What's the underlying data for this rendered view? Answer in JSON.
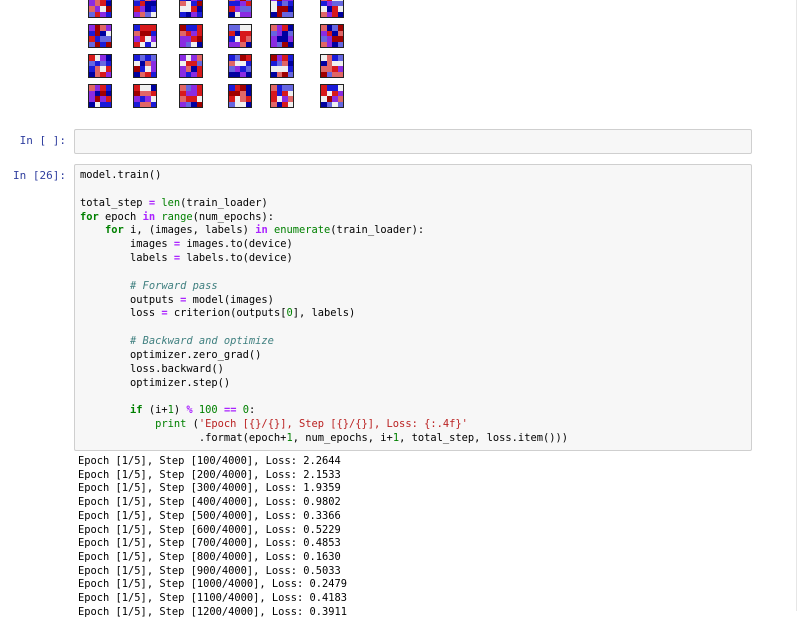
{
  "filter_colors": {
    "red": "#d7191c",
    "blue": "#1a1ad8",
    "light": "#f0f0f0"
  },
  "empty_cell": {
    "prompt": "In [ ]:"
  },
  "code_cell": {
    "prompt": "In [26]:",
    "lines": [
      "model.train()",
      "",
      "total_step = len(train_loader)",
      "for epoch in range(num_epochs):",
      "    for i, (images, labels) in enumerate(train_loader):",
      "        images = images.to(device)",
      "        labels = labels.to(device)",
      "",
      "        # Forward pass",
      "        outputs = model(images)",
      "        loss = criterion(outputs[0], labels)",
      "",
      "        # Backward and optimize",
      "        optimizer.zero_grad()",
      "        loss.backward()",
      "        optimizer.step()",
      "",
      "        if (i+1) % 100 == 0:",
      "            print ('Epoch [{}/{}], Step [{}/{}], Loss: {:.4f}'",
      "                   .format(epoch+1, num_epochs, i+1, total_step, loss.item()))"
    ]
  },
  "output": {
    "lines": [
      "Epoch [1/5], Step [100/4000], Loss: 2.2644",
      "Epoch [1/5], Step [200/4000], Loss: 2.1533",
      "Epoch [1/5], Step [300/4000], Loss: 1.9359",
      "Epoch [1/5], Step [400/4000], Loss: 0.9802",
      "Epoch [1/5], Step [500/4000], Loss: 0.3366",
      "Epoch [1/5], Step [600/4000], Loss: 0.5229",
      "Epoch [1/5], Step [700/4000], Loss: 0.4853",
      "Epoch [1/5], Step [800/4000], Loss: 0.1630",
      "Epoch [1/5], Step [900/4000], Loss: 0.5033",
      "Epoch [1/5], Step [1000/4000], Loss: 0.2479",
      "Epoch [1/5], Step [1100/4000], Loss: 0.4183",
      "Epoch [1/5], Step [1200/4000], Loss: 0.3911"
    ]
  }
}
